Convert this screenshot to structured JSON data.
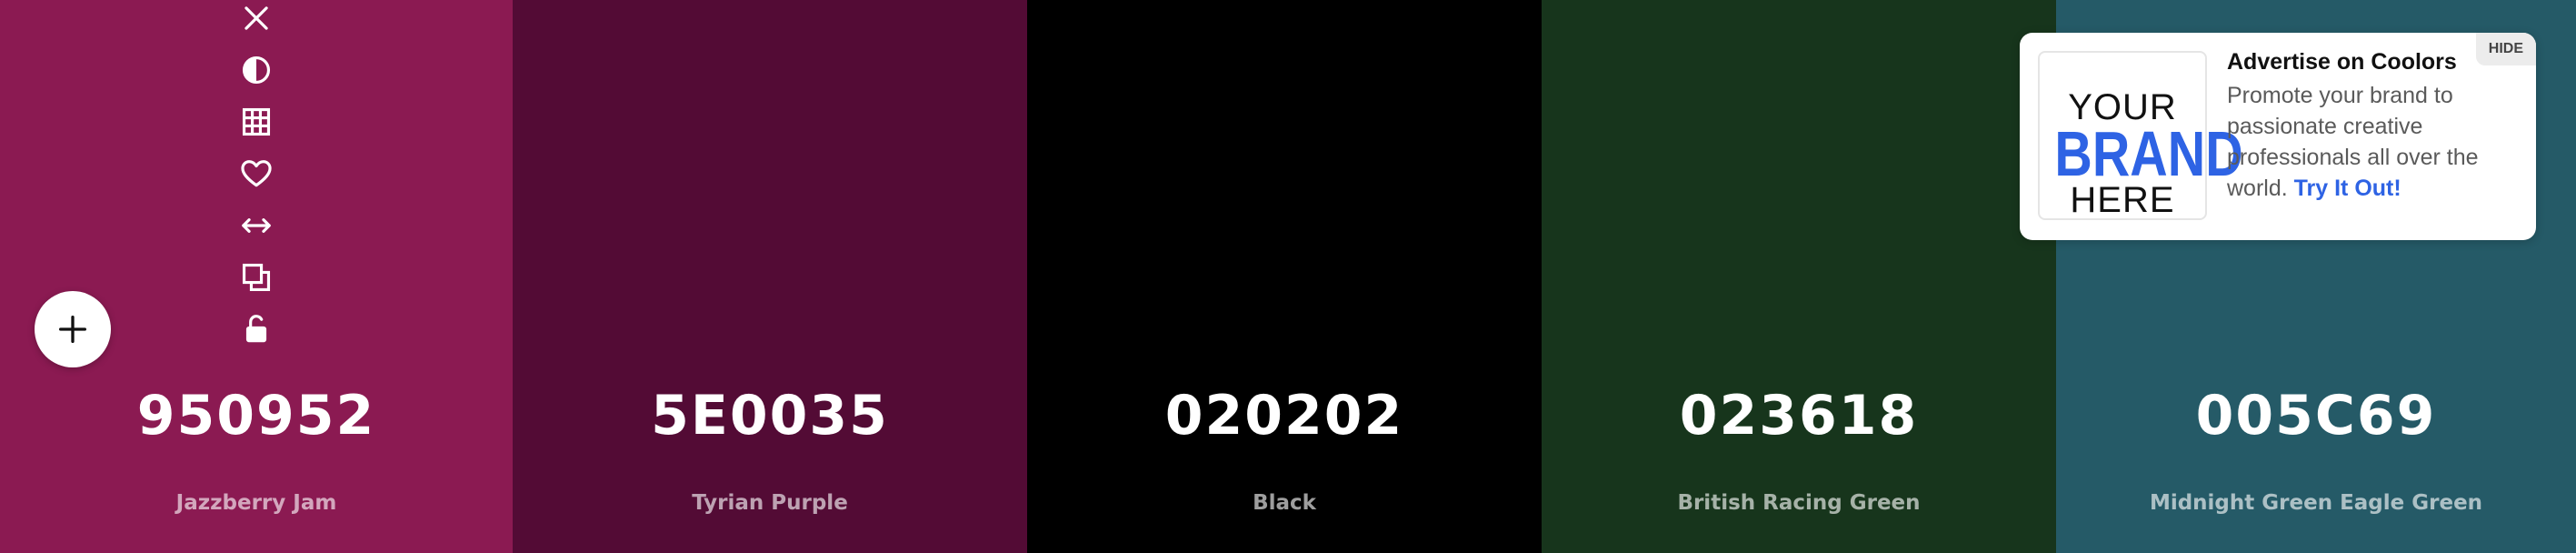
{
  "palette": {
    "swatches": [
      {
        "hex": "950952",
        "name": "Jazzberry Jam",
        "color": "#8b1a52"
      },
      {
        "hex": "5E0035",
        "name": "Tyrian Purple",
        "color": "#530b35"
      },
      {
        "hex": "020202",
        "name": "Black",
        "color": "#000000"
      },
      {
        "hex": "023618",
        "name": "British Racing Green",
        "color": "#17351c"
      },
      {
        "hex": "005C69",
        "name": "Midnight Green Eagle Green",
        "color": "#255a67"
      }
    ]
  },
  "tools": {
    "icons": [
      "close-icon",
      "contrast-icon",
      "grid-icon",
      "heart-icon",
      "arrows-horizontal-icon",
      "copy-icon",
      "unlock-icon"
    ]
  },
  "add_button": {
    "icon": "plus-icon"
  },
  "ad": {
    "hide_label": "HIDE",
    "logo_line1": "YOUR",
    "logo_line2": "BRAND",
    "logo_line3": "HERE",
    "title": "Advertise on Coolors",
    "body": "Promote your brand to passionate creative professionals all over the world.",
    "link": "Try It Out!",
    "link_color": "#2e63e4"
  }
}
